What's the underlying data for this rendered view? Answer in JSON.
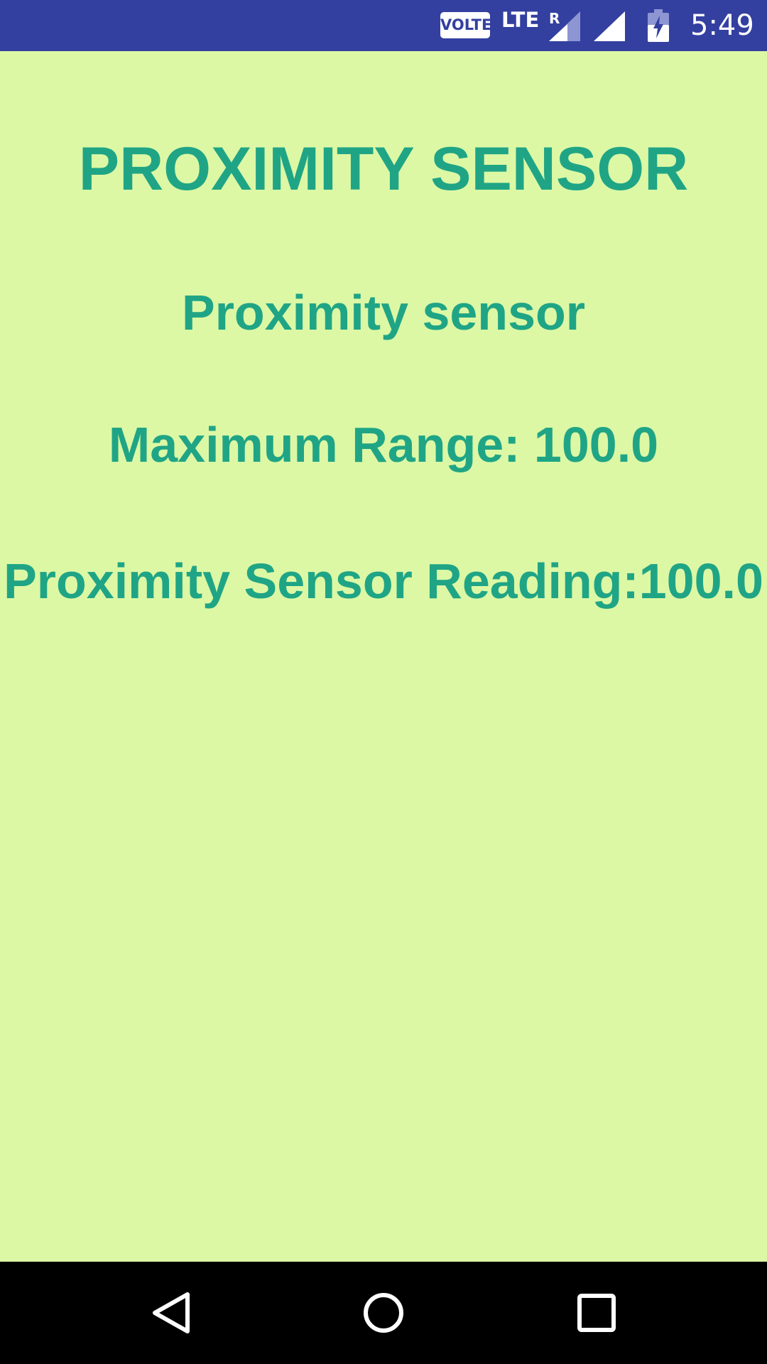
{
  "status_bar": {
    "volte_label": "VOLTE",
    "network_label": "LTE",
    "roaming_label": "R",
    "time": "5:49",
    "background_color": "#3340a0",
    "icons": [
      "volte-badge",
      "signal-roaming-icon",
      "signal-icon",
      "battery-charging-icon"
    ]
  },
  "main": {
    "title": "PROXIMITY SENSOR",
    "sensor_name": "Proximity sensor",
    "max_range": "Maximum Range: 100.0",
    "reading": "Proximity Sensor Reading:100.0",
    "background_color": "#dcf8a5",
    "text_color": "#1fa585"
  },
  "nav_bar": {
    "icons": [
      "back-icon",
      "home-icon",
      "recents-icon"
    ]
  }
}
